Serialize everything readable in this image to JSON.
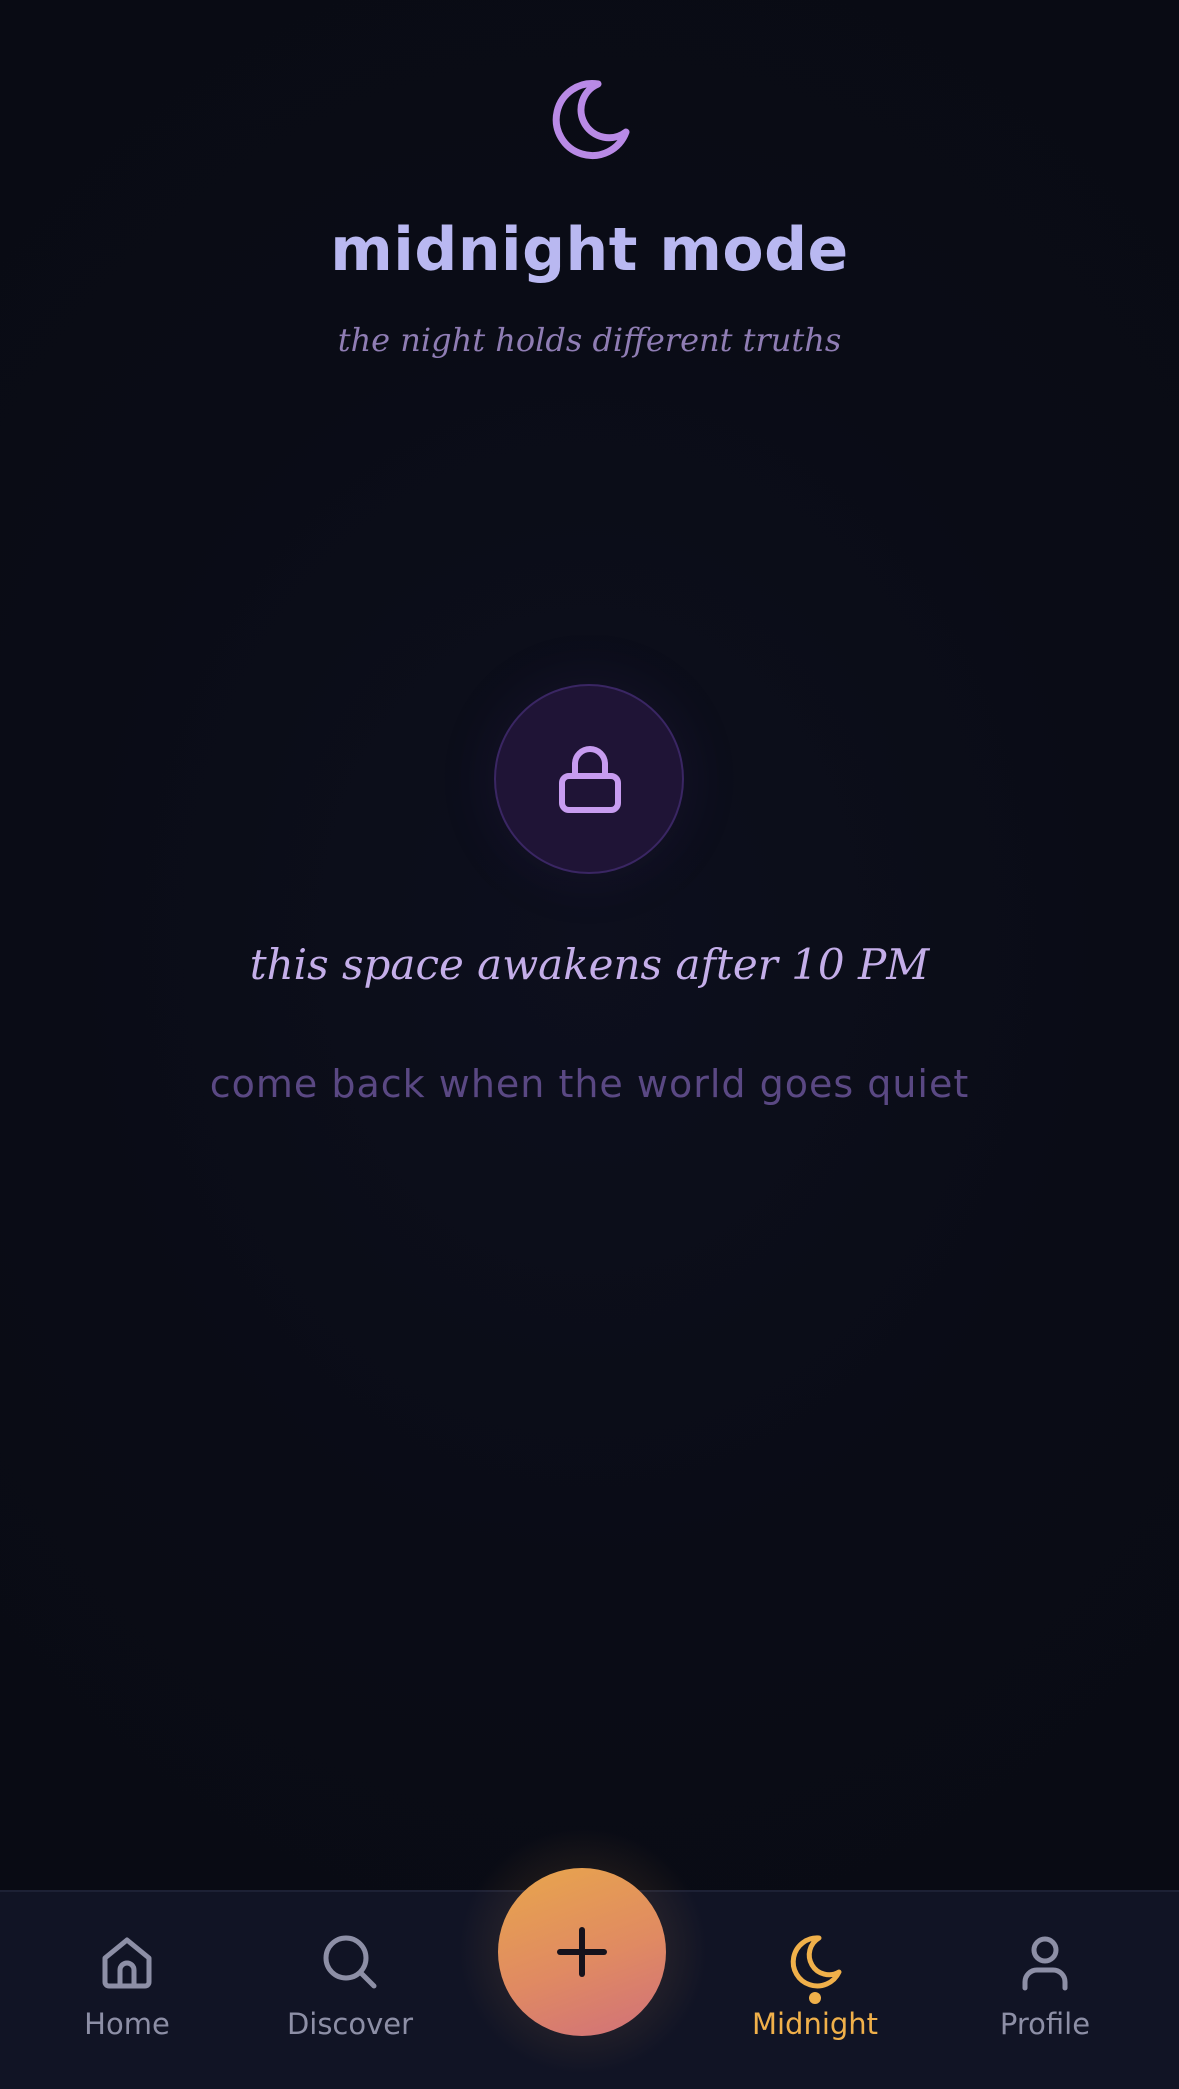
{
  "header": {
    "icon": "moon-icon",
    "title": "midnight mode",
    "subtitle": "the night holds different truths"
  },
  "locked_state": {
    "icon": "lock-icon",
    "title": "this space awakens after 10 PM",
    "message": "come back when the world goes quiet"
  },
  "nav": {
    "items": [
      {
        "label": "Home",
        "icon": "home-icon",
        "active": false
      },
      {
        "label": "Discover",
        "icon": "search-icon",
        "active": false
      },
      {
        "label": "Midnight",
        "icon": "moon-icon",
        "active": true
      },
      {
        "label": "Profile",
        "icon": "user-icon",
        "active": false
      }
    ],
    "fab": {
      "icon": "plus-icon"
    }
  },
  "colors": {
    "background": "#0a0c16",
    "title": "#b9b8f1",
    "accent_purple": "#b98ae6",
    "active_tab": "#f0b04a",
    "inactive_tab": "#8d8fa6",
    "fab_gradient": [
      "#e8a64c",
      "#d0707a"
    ]
  }
}
